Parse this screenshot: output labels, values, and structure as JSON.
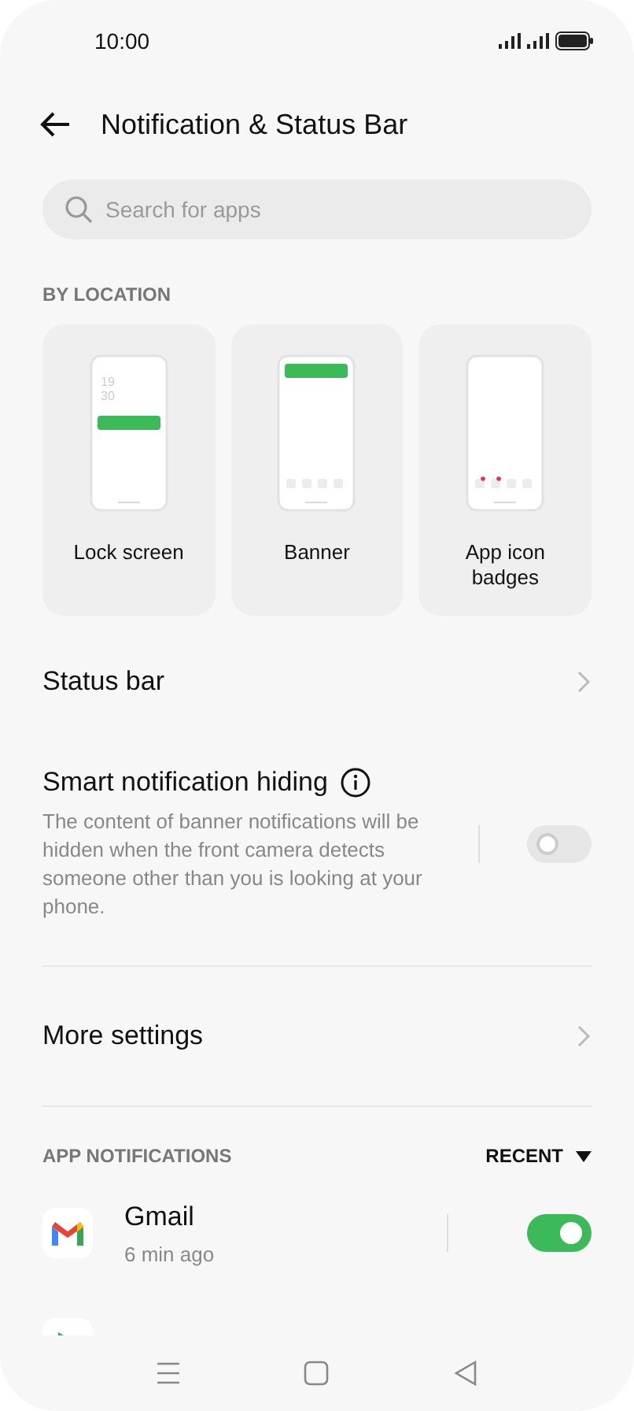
{
  "status_bar": {
    "time": "10:00"
  },
  "header": {
    "title": "Notification & Status Bar"
  },
  "search": {
    "placeholder": "Search for apps"
  },
  "by_location": {
    "heading": "BY LOCATION",
    "cards": [
      {
        "kind": "lock",
        "label": "Lock screen",
        "clock": [
          "19",
          "30"
        ]
      },
      {
        "kind": "banner",
        "label": "Banner"
      },
      {
        "kind": "badges",
        "label": "App icon badges"
      }
    ]
  },
  "settings": [
    {
      "kind": "link",
      "title": "Status bar"
    },
    {
      "kind": "toggle",
      "title": "Smart notification hiding",
      "description": "The content of banner notifications will be hidden when the front camera detects someone other than you is looking at your phone.",
      "on": false
    },
    {
      "kind": "link",
      "title": "More settings"
    }
  ],
  "app_notifications": {
    "heading": "APP NOTIFICATIONS",
    "sort": "RECENT",
    "apps": [
      {
        "kind": "gmail",
        "name": "Gmail",
        "time": "6 min ago",
        "on": true
      },
      {
        "kind": "play"
      }
    ]
  }
}
